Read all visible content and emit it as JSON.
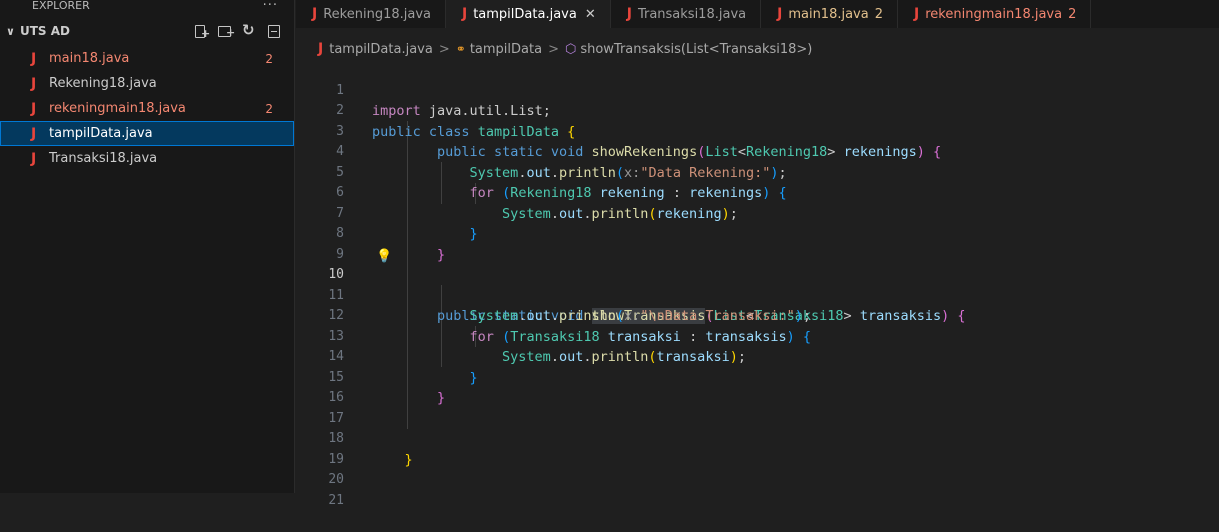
{
  "sidebar": {
    "header": "EXPLORER",
    "header_more": "···",
    "folder_name": "UTS AD",
    "files": [
      {
        "name": "main18.java",
        "problems": "2",
        "status": "error"
      },
      {
        "name": "Rekening18.java",
        "problems": "",
        "status": "normal"
      },
      {
        "name": "rekeningmain18.java",
        "problems": "2",
        "status": "error"
      },
      {
        "name": "tampilData.java",
        "problems": "",
        "status": "selected"
      },
      {
        "name": "Transaksi18.java",
        "problems": "",
        "status": "normal"
      }
    ]
  },
  "tabs": [
    {
      "label": "Rekening18.java",
      "badge": ""
    },
    {
      "label": "tampilData.java",
      "badge": "",
      "close": "✕"
    },
    {
      "label": "Transaksi18.java",
      "badge": ""
    },
    {
      "label": "main18.java",
      "badge": "2"
    },
    {
      "label": "rekeningmain18.java",
      "badge": "2"
    }
  ],
  "breadcrumb": {
    "file": "tampilData.java",
    "cls": "tampilData",
    "method": "showTransaksis(List<Transaksi18>)"
  },
  "editor": {
    "current_line": "10",
    "lines": [
      {
        "n": "1"
      },
      {
        "n": "2"
      },
      {
        "n": "3"
      },
      {
        "n": "4"
      },
      {
        "n": "5"
      },
      {
        "n": "6"
      },
      {
        "n": "7"
      },
      {
        "n": "8"
      },
      {
        "n": "9"
      },
      {
        "n": "10"
      },
      {
        "n": "11"
      },
      {
        "n": "12"
      },
      {
        "n": "13"
      },
      {
        "n": "14"
      },
      {
        "n": "15"
      },
      {
        "n": "16"
      },
      {
        "n": "17"
      },
      {
        "n": "18"
      },
      {
        "n": "19"
      },
      {
        "n": "20"
      },
      {
        "n": "21"
      }
    ],
    "tokens": {
      "l1": [
        "import",
        " java.util.List;"
      ],
      "l2": [
        "public",
        "class",
        "tampilData",
        "{"
      ],
      "l3": [
        "public",
        "static",
        "void",
        "showRekenings",
        "(",
        "List",
        "<",
        "Rekening18",
        ">",
        "rekenings",
        ")",
        "{"
      ],
      "l4": [
        "System",
        ".",
        "out",
        ".",
        "println",
        "(",
        "x:",
        "\"Data Rekening:\"",
        ")",
        ";"
      ],
      "l5": [
        "for",
        "(",
        "Rekening18",
        "rekening",
        ":",
        "rekenings",
        ")",
        "{"
      ],
      "l6": [
        "System",
        ".",
        "out",
        ".",
        "println",
        "(",
        "rekening",
        ")",
        ";"
      ],
      "l7": [
        "}"
      ],
      "l8": [
        "}"
      ],
      "l10": [
        "public",
        "static",
        "void",
        "showTransaksis",
        "(",
        "List",
        "<",
        "Transaksi18",
        ">",
        "transaksis",
        ")",
        "{"
      ],
      "l11": [
        "System",
        ".",
        "out",
        ".",
        "println",
        "(",
        "x:",
        "\"\\nData Transaksi:\"",
        ")",
        ";"
      ],
      "l12": [
        "for",
        "(",
        "Transaksi18",
        "transaksi",
        ":",
        "transaksis",
        ")",
        "{"
      ],
      "l13": [
        "System",
        ".",
        "out",
        ".",
        "println",
        "(",
        "transaksi",
        ")",
        ";"
      ],
      "l14": [
        "}"
      ],
      "l15": [
        "}"
      ],
      "l18": [
        "}"
      ]
    }
  }
}
